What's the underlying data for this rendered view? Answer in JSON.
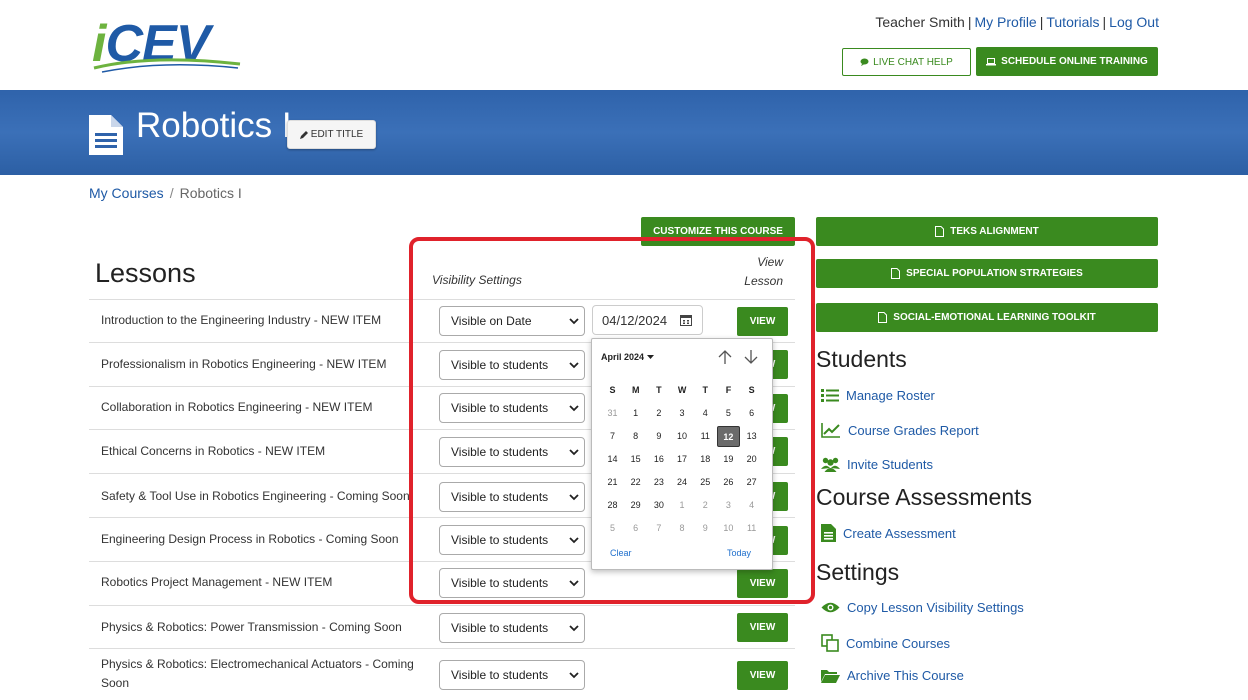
{
  "header": {
    "logo_text_i": "i",
    "logo_text_cev": "CEV",
    "user_name": "Teacher Smith",
    "links": [
      "My Profile",
      "Tutorials",
      "Log Out"
    ],
    "live_chat_label": "LIVE CHAT HELP",
    "schedule_label": "SCHEDULE ONLINE TRAINING"
  },
  "banner": {
    "title": "Robotics I",
    "edit_label": "EDIT TITLE"
  },
  "breadcrumb": {
    "root": "My Courses",
    "current": "Robotics I",
    "separator": "/"
  },
  "main": {
    "customize_label": "CUSTOMIZE THIS COURSE",
    "lessons_heading": "Lessons",
    "col_visibility": "Visibility Settings",
    "col_view_1": "View",
    "col_view_2": "Lesson",
    "view_label": "VIEW",
    "date_value": "04/12/2024",
    "lessons": [
      {
        "name": "Introduction to the Engineering Industry - NEW ITEM",
        "visibility": "Visible on Date"
      },
      {
        "name": "Professionalism in Robotics Engineering - NEW ITEM",
        "visibility": "Visible to students"
      },
      {
        "name": "Collaboration in Robotics Engineering - NEW ITEM",
        "visibility": "Visible to students"
      },
      {
        "name": "Ethical Concerns in Robotics - NEW ITEM",
        "visibility": "Visible to students"
      },
      {
        "name": "Safety & Tool Use in Robotics Engineering - Coming Soon",
        "visibility": "Visible to students"
      },
      {
        "name": "Engineering Design Process in Robotics - Coming Soon",
        "visibility": "Visible to students"
      },
      {
        "name": "Robotics Project Management - NEW ITEM",
        "visibility": "Visible to students"
      },
      {
        "name": "Physics & Robotics: Power Transmission - Coming Soon",
        "visibility": "Visible to students"
      },
      {
        "name": "Physics & Robotics: Electromechanical Actuators - Coming Soon",
        "visibility": "Visible to students"
      }
    ]
  },
  "calendar": {
    "month_label": "April 2024",
    "weekdays": [
      "S",
      "M",
      "T",
      "W",
      "T",
      "F",
      "S"
    ],
    "weeks": [
      [
        "31",
        "1",
        "2",
        "3",
        "4",
        "5",
        "6"
      ],
      [
        "7",
        "8",
        "9",
        "10",
        "11",
        "12",
        "13"
      ],
      [
        "14",
        "15",
        "16",
        "17",
        "18",
        "19",
        "20"
      ],
      [
        "21",
        "22",
        "23",
        "24",
        "25",
        "26",
        "27"
      ],
      [
        "28",
        "29",
        "30",
        "1",
        "2",
        "3",
        "4"
      ],
      [
        "5",
        "6",
        "7",
        "8",
        "9",
        "10",
        "11"
      ]
    ],
    "selected": "12",
    "clear_label": "Clear",
    "today_label": "Today"
  },
  "sidebar": {
    "teks_label": "TEKS ALIGNMENT",
    "special_label": "SPECIAL POPULATION STRATEGIES",
    "sel_label": "SOCIAL-EMOTIONAL LEARNING TOOLKIT",
    "students_heading": "Students",
    "manage_roster": "Manage Roster",
    "grades_report": "Course Grades Report",
    "invite_students": "Invite Students",
    "assessments_heading": "Course Assessments",
    "create_assessment": "Create Assessment",
    "settings_heading": "Settings",
    "copy_visibility": "Copy Lesson Visibility Settings",
    "combine_courses": "Combine Courses",
    "archive_course": "Archive This Course"
  },
  "colors": {
    "brand_blue": "#1f5aa6",
    "brand_green": "#3a8a1f",
    "highlight_red": "#e0222b"
  }
}
